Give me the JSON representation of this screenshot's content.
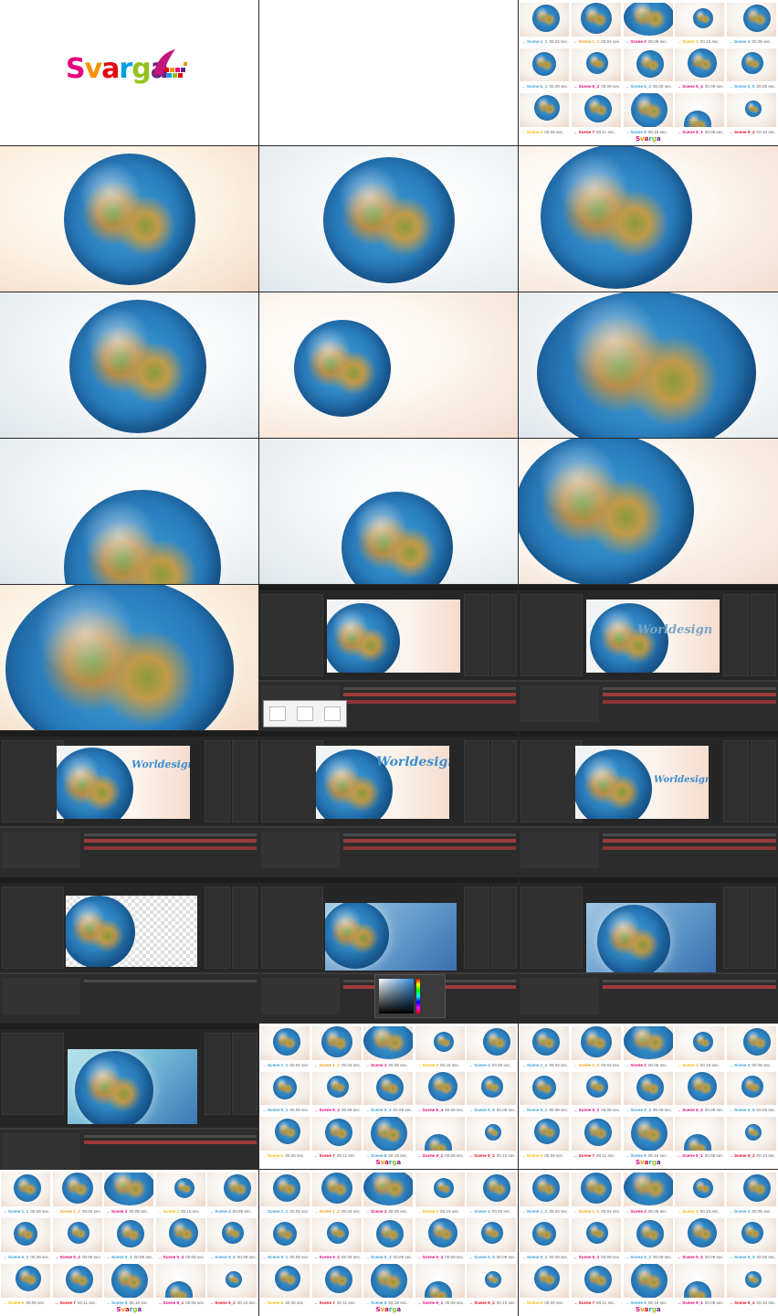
{
  "logo": {
    "text": "Svarga",
    "letters": [
      {
        "ch": "S",
        "color": "#e6007e"
      },
      {
        "ch": "v",
        "color": "#f39200"
      },
      {
        "ch": "a",
        "color": "#e30613"
      },
      {
        "ch": "r",
        "color": "#009fe3"
      },
      {
        "ch": "g",
        "color": "#95c11f"
      },
      {
        "ch": "a",
        "color": "#662483"
      }
    ]
  },
  "overlay_text": {
    "worldesign_1": "Worldesign",
    "worldesign_2": "Worldesign",
    "worldesign_3": "Worldesign",
    "worldesign_4": "Worldesign"
  },
  "scene_sheet": {
    "logo_text": "Svarga",
    "scenes": [
      {
        "name": "Scene 1_1",
        "time": "00.04 sec.",
        "color": "#3aa0d8"
      },
      {
        "name": "Scene 1_2",
        "time": "00.04 sec.",
        "color": "#f39c12"
      },
      {
        "name": "Scene 2",
        "time": "00.05 sec.",
        "color": "#e6007e"
      },
      {
        "name": "Scene 3",
        "time": "00.15 sec.",
        "color": "#f5b700"
      },
      {
        "name": "Scene 4",
        "time": "00.05 sec.",
        "color": "#3aa0d8"
      },
      {
        "name": "Scene 5_1",
        "time": "00.09 sec.",
        "color": "#3aa0d8"
      },
      {
        "name": "Scene 5_2",
        "time": "00.09 sec.",
        "color": "#e6007e"
      },
      {
        "name": "Scene 5_3",
        "time": "00.09 sec.",
        "color": "#3aa0d8"
      },
      {
        "name": "Scene 5_4",
        "time": "00.09 sec.",
        "color": "#e6007e"
      },
      {
        "name": "Scene 5_5",
        "time": "00.09 sec.",
        "color": "#3aa0d8"
      },
      {
        "name": "Scene 6",
        "time": "00.06 sec.",
        "color": "#f5b700"
      },
      {
        "name": "Scene 7",
        "time": "00.11 sec.",
        "color": "#e30613"
      },
      {
        "name": "Scene 8",
        "time": "00.18 sec.",
        "color": "#3aa0d8"
      },
      {
        "name": "Scene 9_1",
        "time": "00.08 sec.",
        "color": "#e6007e"
      },
      {
        "name": "Scene 9_2",
        "time": "00.10 sec.",
        "color": "#e30613"
      }
    ]
  }
}
